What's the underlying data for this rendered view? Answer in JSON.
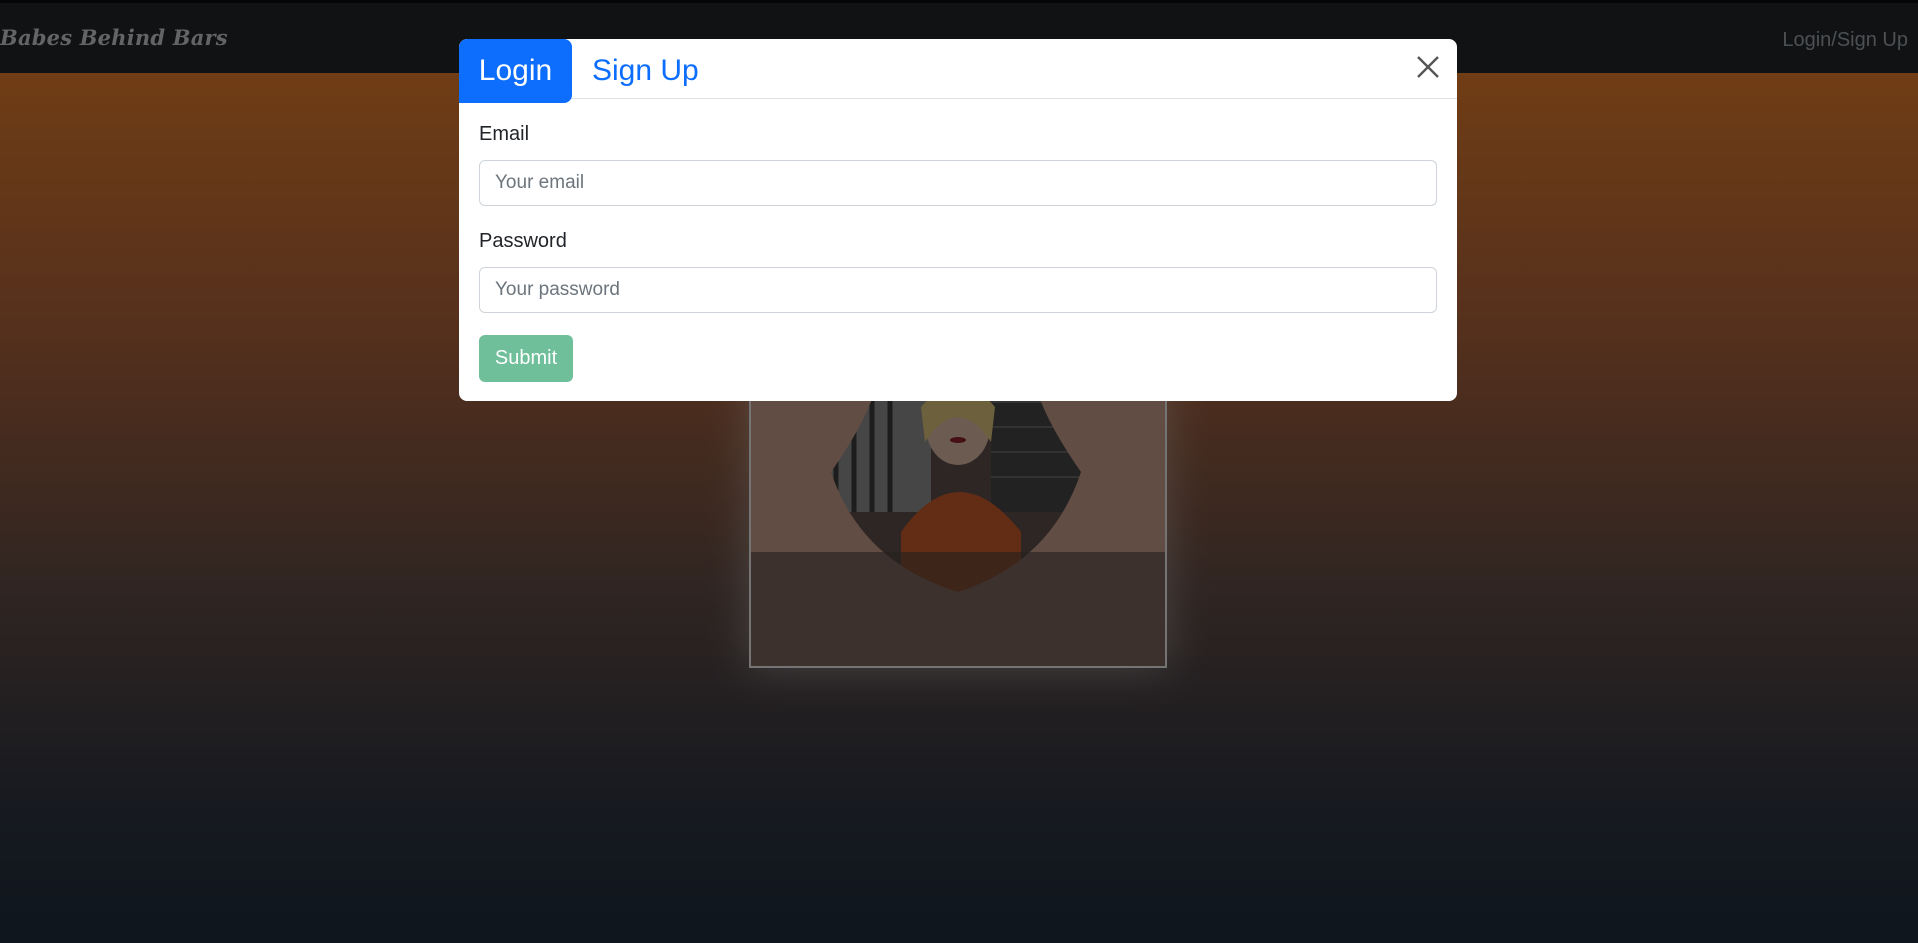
{
  "navbar": {
    "brand": "Babes Behind Bars",
    "login_signup_link": "Login/Sign Up"
  },
  "modal": {
    "tabs": [
      {
        "label": "Login",
        "active": true
      },
      {
        "label": "Sign Up",
        "active": false
      }
    ],
    "close_icon": "close-icon",
    "email": {
      "label": "Email",
      "placeholder": "Your email",
      "value": ""
    },
    "password": {
      "label": "Password",
      "placeholder": "Your password",
      "value": ""
    },
    "submit_label": "Submit"
  },
  "colors": {
    "primary": "#0d6efd",
    "submit": "#6fbf9a",
    "navbar": "#212529"
  }
}
